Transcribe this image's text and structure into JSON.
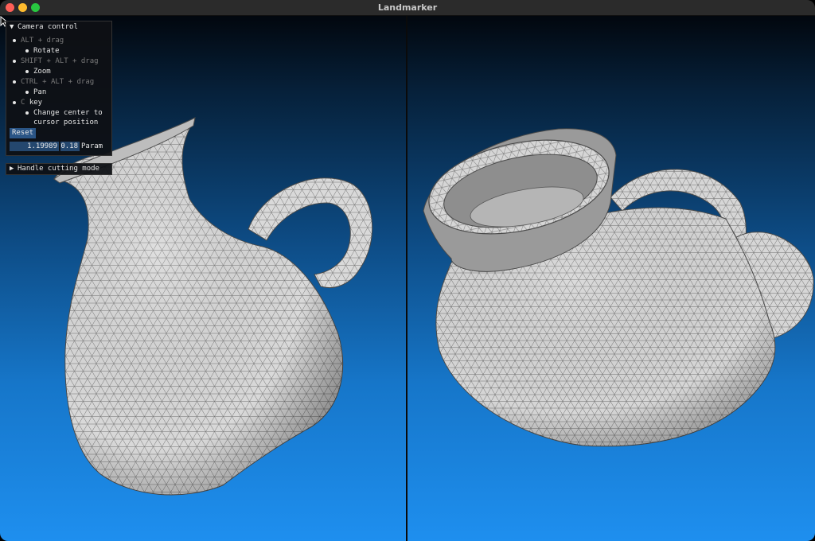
{
  "window": {
    "title": "Landmarker"
  },
  "camera_panel": {
    "header": "Camera control",
    "items": [
      {
        "mod_parts": [
          "ALT",
          "+",
          "drag"
        ],
        "action": "Rotate"
      },
      {
        "mod_parts": [
          "SHIFT",
          "+",
          "ALT",
          "+",
          "drag"
        ],
        "action": "Zoom"
      },
      {
        "mod_parts": [
          "CTRL",
          "+",
          "ALT",
          "+",
          "drag"
        ],
        "action": "Pan"
      },
      {
        "mod_parts": [
          "C",
          "key"
        ],
        "action_lines": [
          "Change center to",
          "cursor position"
        ]
      }
    ],
    "reset_label": "Reset",
    "param_value_1": "1.19989",
    "param_value_2": "0.18",
    "param_label": "Param"
  },
  "handle_panel": {
    "header": "Handle cutting mode"
  },
  "colors": {
    "title_bar": "#2b2b2b",
    "panel_bg": "#0e1014",
    "button": "#2a5586",
    "field": "#24476e",
    "mesh_fill": "#d9d9d9",
    "mesh_edge": "#6f6f6f",
    "background_top": "#02070e",
    "background_bottom": "#1e8fef"
  },
  "icons": [
    "close-icon",
    "minimize-icon",
    "maximize-icon",
    "collapse-arrow-icon",
    "expand-arrow-icon",
    "mouse-cursor-icon"
  ]
}
